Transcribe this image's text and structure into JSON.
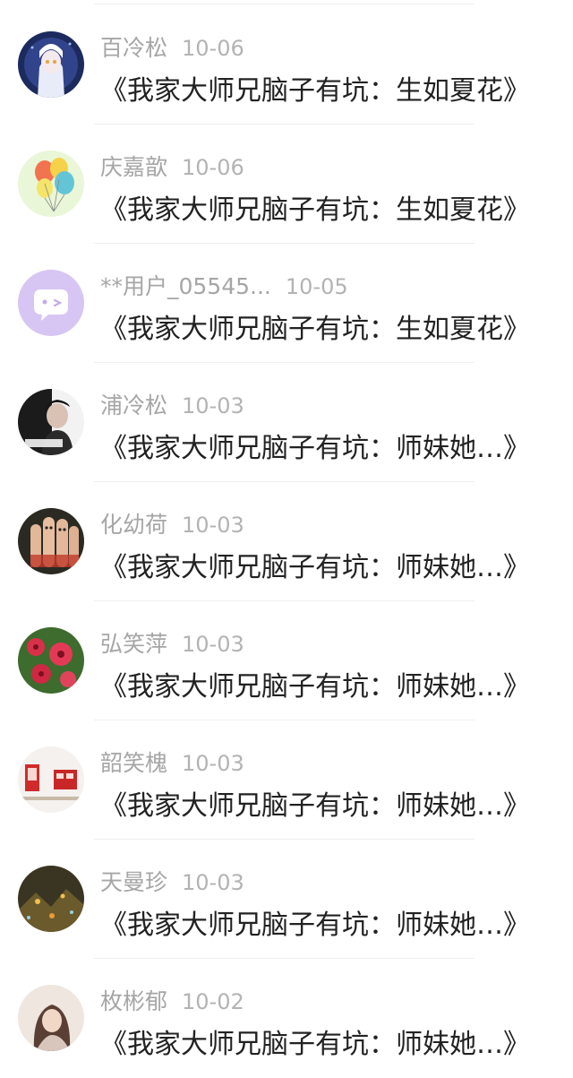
{
  "comments": [
    {
      "name": "百冷松",
      "date": "10-06",
      "title": "《我家大师兄脑子有坑：生如夏花》",
      "avatar_icon": "anime-girl-avatar"
    },
    {
      "name": "庆嘉歆",
      "date": "10-06",
      "title": "《我家大师兄脑子有坑：生如夏花》",
      "avatar_icon": "balloons-avatar"
    },
    {
      "name": "**用户_05545...",
      "date": "10-05",
      "title": "《我家大师兄脑子有坑：生如夏花》",
      "avatar_icon": "wink-face-avatar"
    },
    {
      "name": "浦冷松",
      "date": "10-03",
      "title": "《我家大师兄脑子有坑：师妹她…》",
      "avatar_icon": "portrait-avatar"
    },
    {
      "name": "化幼荷",
      "date": "10-03",
      "title": "《我家大师兄脑子有坑：师妹她…》",
      "avatar_icon": "finger-faces-avatar"
    },
    {
      "name": "弘笑萍",
      "date": "10-03",
      "title": "《我家大师兄脑子有坑：师妹她…》",
      "avatar_icon": "red-flowers-avatar"
    },
    {
      "name": "韶笑槐",
      "date": "10-03",
      "title": "《我家大师兄脑子有坑：师妹她…》",
      "avatar_icon": "red-phonebooth-avatar"
    },
    {
      "name": "天曼珍",
      "date": "10-03",
      "title": "《我家大师兄脑子有坑：师妹她…》",
      "avatar_icon": "city-night-avatar"
    },
    {
      "name": "枚彬郁",
      "date": "10-02",
      "title": "《我家大师兄脑子有坑：师妹她…》",
      "avatar_icon": "woman-portrait-avatar"
    }
  ]
}
